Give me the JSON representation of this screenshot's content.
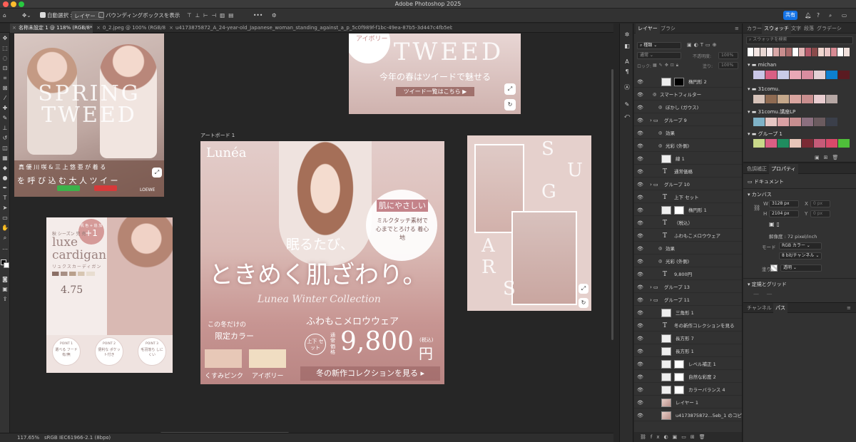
{
  "app_title": "Adobe Photoshop 2025",
  "options": {
    "auto_select_label": "自動選択 :",
    "auto_select_value": "レイヤー",
    "bbox_label": "バウンディングボックスを表示",
    "share_label": "共有"
  },
  "tabs": [
    "名称未設定 1 @ 118% (RGB/8*)",
    "0_2.jpeg @ 100% (RGB/8#)",
    "u4173875872_A_24-year-old_Japanese_woman_standing_against_a_p_5c0f989f-f1bc-49ea-87b5-3d447c4fb5eb_1.png @ 100% (RGB/8#)"
  ],
  "status": {
    "zoom": "117.65%",
    "profile": "sRGB IEC61966-2.1 (8bpc)"
  },
  "artboard_label": "アートボード 1",
  "banner_spring": {
    "line1": "SPRING",
    "line2": "TWEED",
    "caption1": "真 優 川 咲 & 三 上 悠 亜 が 着 る",
    "caption2": "を 呼 び 込 む 大 人 ツ イ ー",
    "brand": "LOEWE"
  },
  "banner_tweed": {
    "top_label": "アイボリー",
    "title": "TWEED",
    "subtitle": "今年の春はツイードで魅せる",
    "cta": "ツイード一覧はこちら"
  },
  "banner_cardigan": {
    "badge_top": "机 色 + 追 加",
    "badge_num": "+1",
    "season": "秋 シーズン 完 売",
    "title1": "luxe",
    "title2": "cardigan",
    "kana": "リュクスカーディガン",
    "rating": "4.75",
    "points": [
      {
        "label": "POINT 1",
        "text": "選べる フード有/無"
      },
      {
        "label": "POINT 2",
        "text": "便利な ポケット付き"
      },
      {
        "label": "POINT 3",
        "text": "毛羽落ち しにくい"
      }
    ]
  },
  "banner_lunea": {
    "brand": "Lunéa",
    "badge_title": "肌にやさしい",
    "badge_text": "ミルクタッチ素材で 心までとろける 着心地",
    "headline1": "眠るたび、",
    "headline2": "ときめく肌ざわり。",
    "collection": "Lunea Winter Collection",
    "product": "ふわもこメロウウェア",
    "limited_top": "この冬だけの",
    "limited": "限定カラー",
    "set_label": "上下 セット",
    "price_label": "通常 価格",
    "price": "9,800",
    "yen": "円",
    "tax": "(税込)",
    "colors": [
      "くすみピンク",
      "アイボリー"
    ],
    "cta": "冬の新作コレクションを見る"
  },
  "banner_sugars": {
    "letters": [
      "S",
      "U",
      "G",
      "A",
      "R",
      "S"
    ]
  },
  "layers_panel": {
    "tabs": [
      "レイヤー",
      "ブラシ"
    ],
    "kind": "種類",
    "blend": "通常",
    "opacity_label": "不透明度:",
    "opacity": "100%",
    "lock_label": "ロック:",
    "fill_label": "塗り:",
    "fill": "100%",
    "rows": [
      {
        "name": "楕円形 2",
        "type": "shape"
      },
      {
        "name": "スマートフィルター",
        "type": "sub"
      },
      {
        "name": "ぼかし (ガウス)",
        "type": "effect"
      },
      {
        "name": "グループ 9",
        "type": "group"
      },
      {
        "name": "効果",
        "type": "effect"
      },
      {
        "name": "光彩 (外側)",
        "type": "effect"
      },
      {
        "name": "線 1",
        "type": "shape"
      },
      {
        "name": "通常価格",
        "type": "text"
      },
      {
        "name": "グループ 10",
        "type": "group"
      },
      {
        "name": "上下 セット",
        "type": "text"
      },
      {
        "name": "楕円形 1",
        "type": "shape"
      },
      {
        "name": "（税込）",
        "type": "text"
      },
      {
        "name": "ふわもこメロウウェア",
        "type": "text"
      },
      {
        "name": "効果",
        "type": "effect"
      },
      {
        "name": "光彩 (外側)",
        "type": "effect"
      },
      {
        "name": "9,800円",
        "type": "text"
      },
      {
        "name": "グループ 13",
        "type": "group"
      },
      {
        "name": "グループ 11",
        "type": "group"
      },
      {
        "name": "三角形 1",
        "type": "shape"
      },
      {
        "name": "冬の新作コレクションを見る",
        "type": "text"
      },
      {
        "name": "長方形 7",
        "type": "shape"
      },
      {
        "name": "長方形 1",
        "type": "shape"
      },
      {
        "name": "レベル補正 1",
        "type": "adj"
      },
      {
        "name": "自然な彩度 2",
        "type": "adj"
      },
      {
        "name": "カラーバランス 4",
        "type": "adj"
      },
      {
        "name": "レイヤー 1",
        "type": "img"
      },
      {
        "name": "u4173875872...5eb_1 のコピー",
        "type": "img"
      }
    ]
  },
  "swatch_panel": {
    "tabs": [
      "カラー",
      "スウォッチ",
      "文字",
      "段落",
      "グラデーシ"
    ],
    "search": "スウォッチを検索",
    "groups": [
      "michan",
      "31comu.",
      "31comu.講座LP",
      "グループ 1"
    ]
  },
  "props_panel": {
    "tabs": [
      "色調補正",
      "プロパティ"
    ],
    "doc": "ドキュメント",
    "canvas_label": "カンバス",
    "w_label": "W",
    "w": "3128 px",
    "h_label": "H",
    "h": "2104 px",
    "x_label": "X",
    "y_label": "Y",
    "x": "0 px",
    "y": "0 px",
    "res": "解像度 : 72 pixel/inch",
    "mode_label": "モード",
    "mode": "RGB カラー",
    "bit": "8 bit/チャンネル",
    "fill_label": "塗り",
    "fill": "透明",
    "guides": "定規とグリッド"
  },
  "bottom_tabs": [
    "チャンネル",
    "パス"
  ],
  "colors": {
    "accent": "#1473e6",
    "rose": "#c98e8e"
  }
}
